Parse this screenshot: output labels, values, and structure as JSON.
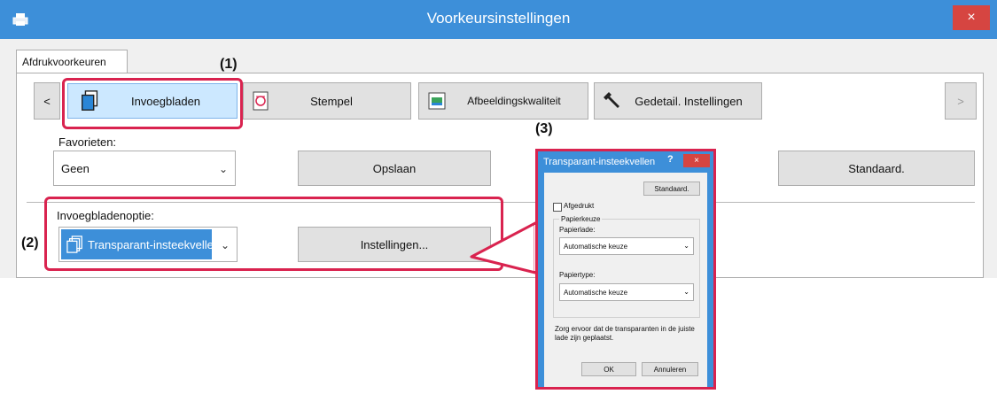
{
  "window": {
    "title": "Voorkeursinstellingen",
    "close_label": "×",
    "tab_label": "Afdrukvoorkeuren"
  },
  "toolbar": {
    "prev_label": "<",
    "next_label": ">",
    "buttons": [
      {
        "label": "Invoegbladen",
        "icon": "insert-sheets-icon"
      },
      {
        "label": "Stempel",
        "icon": "stamp-icon"
      },
      {
        "label": "Afbeeldingskwaliteit",
        "icon": "image-quality-icon"
      },
      {
        "label": "Gedetail. Instellingen",
        "icon": "wrench-icon"
      }
    ]
  },
  "favorites": {
    "label": "Favorieten:",
    "value": "Geen",
    "save_label": "Opslaan",
    "default_label": "Standaard."
  },
  "insert_option": {
    "label": "Invoegbladenoptie:",
    "value": "Transparant-insteekvellen",
    "settings_label": "Instellingen..."
  },
  "callouts": {
    "one": "(1)",
    "two": "(2)",
    "three": "(3)"
  },
  "dialog": {
    "title": "Transparant-insteekvellen",
    "help_label": "?",
    "close_label": "×",
    "default_label": "Standaard.",
    "printed_label": "Afgedrukt",
    "paper_group": "Papierkeuze",
    "tray_label": "Papierlade:",
    "tray_value": "Automatische keuze",
    "type_label": "Papiertype:",
    "type_value": "Automatische keuze",
    "note": "Zorg ervoor dat de transparanten in de juiste lade zijn geplaatst.",
    "ok_label": "OK",
    "cancel_label": "Annuleren"
  },
  "colors": {
    "accent": "#3d8fd9",
    "highlight": "#d9234f",
    "selected": "#cce8ff",
    "close": "#d64541"
  }
}
